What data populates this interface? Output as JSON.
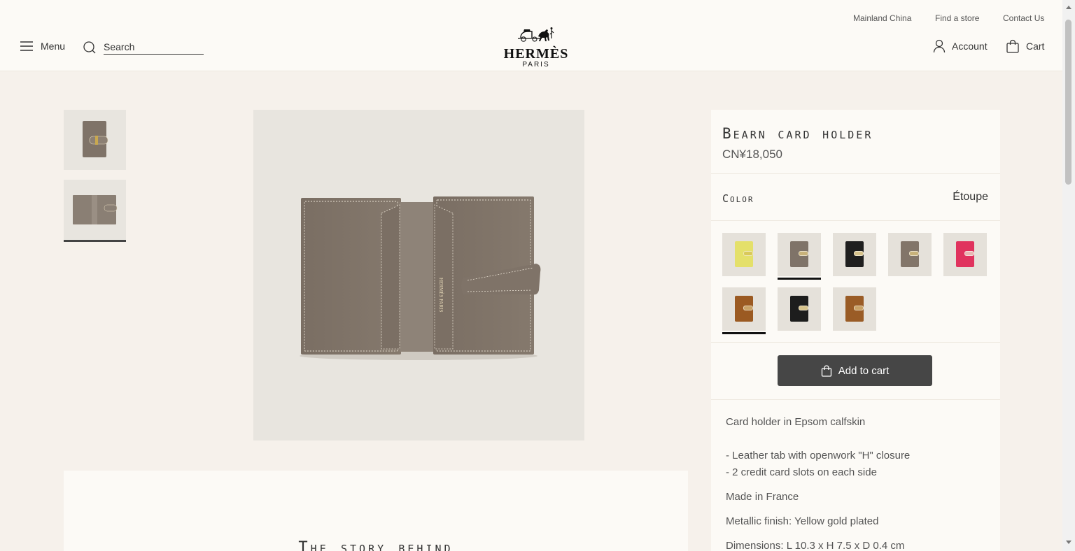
{
  "header": {
    "utility_links": [
      "Mainland China",
      "Find a store",
      "Contact Us"
    ],
    "menu_label": "Menu",
    "search_placeholder": "Search",
    "logo_brand": "HERMÈS",
    "logo_city": "PARIS",
    "account_label": "Account",
    "cart_label": "Cart"
  },
  "gallery": {
    "thumbnails": [
      "thumbnail-front",
      "thumbnail-open"
    ],
    "selected_thumbnail_index": 1
  },
  "story": {
    "title": "The story behind"
  },
  "product": {
    "title": "Bearn card holder",
    "price": "CN¥18,050",
    "color_label": "Color",
    "color_value": "Étoupe",
    "swatches": [
      {
        "color": "#e4e06a",
        "clasp": "#d9c95a"
      },
      {
        "color": "#7f7368",
        "clasp": "#c8b27a"
      },
      {
        "color": "#1f1f1f",
        "clasp": "#d6c28a"
      },
      {
        "color": "#827569",
        "clasp": "#c8b27a"
      },
      {
        "color": "#e0335e",
        "clasp": "#e8b7b2"
      },
      {
        "color": "#9b5a22",
        "clasp": "#c9a266"
      },
      {
        "color": "#1d1d1d",
        "clasp": "#d6c28a"
      },
      {
        "color": "#9a5c26",
        "clasp": "#c9a266"
      }
    ],
    "selected_swatches": [
      1,
      5
    ],
    "add_to_cart_label": "Add to cart",
    "description": [
      "Card holder in Epsom calfskin",
      "- Leather tab with openwork \"H\" closure",
      "- 2 credit card slots on each side",
      "Made in France",
      "Metallic finish: Yellow gold plated",
      "Dimensions: L 10.3 x H 7.5 x D 0.4 cm"
    ]
  },
  "colors": {
    "background": "#f6f1eb",
    "panel": "#fcfaf6",
    "button": "#464646",
    "leather": "#7f7368"
  }
}
